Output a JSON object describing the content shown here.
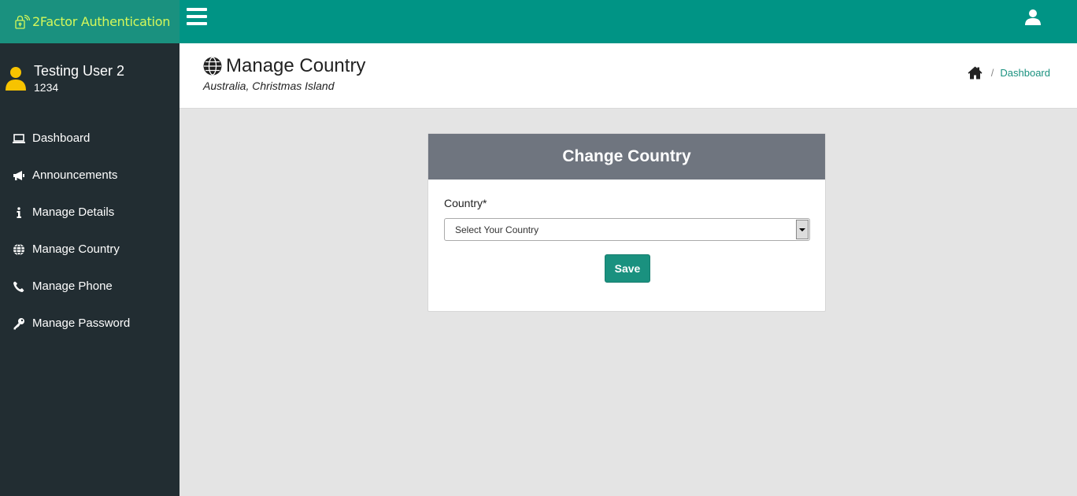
{
  "brand": {
    "title": "2Factor Authentication",
    "color": "#d4f75a"
  },
  "user": {
    "name": "Testing User 2",
    "id": "1234",
    "icon": "user-icon",
    "icon_color": "#f7c300"
  },
  "nav": [
    {
      "label": "Dashboard",
      "icon": "laptop-icon"
    },
    {
      "label": "Announcements",
      "icon": "megaphone-icon"
    },
    {
      "label": "Manage Details",
      "icon": "info-icon"
    },
    {
      "label": "Manage Country",
      "icon": "globe-icon"
    },
    {
      "label": "Manage Phone",
      "icon": "phone-icon"
    },
    {
      "label": "Manage Password",
      "icon": "key-icon"
    }
  ],
  "header": {
    "title": "Manage Country",
    "subtitle": "Australia, Christmas Island",
    "breadcrumb": {
      "sep": "/",
      "link": "Dashboard"
    }
  },
  "form": {
    "heading": "Change Country",
    "country_label": "Country*",
    "country_value": "Select Your Country",
    "save_label": "Save"
  },
  "colors": {
    "topbar": "#009485",
    "sidebar": "#222d32",
    "accent": "#1a917f",
    "card_header": "#6f757f"
  }
}
